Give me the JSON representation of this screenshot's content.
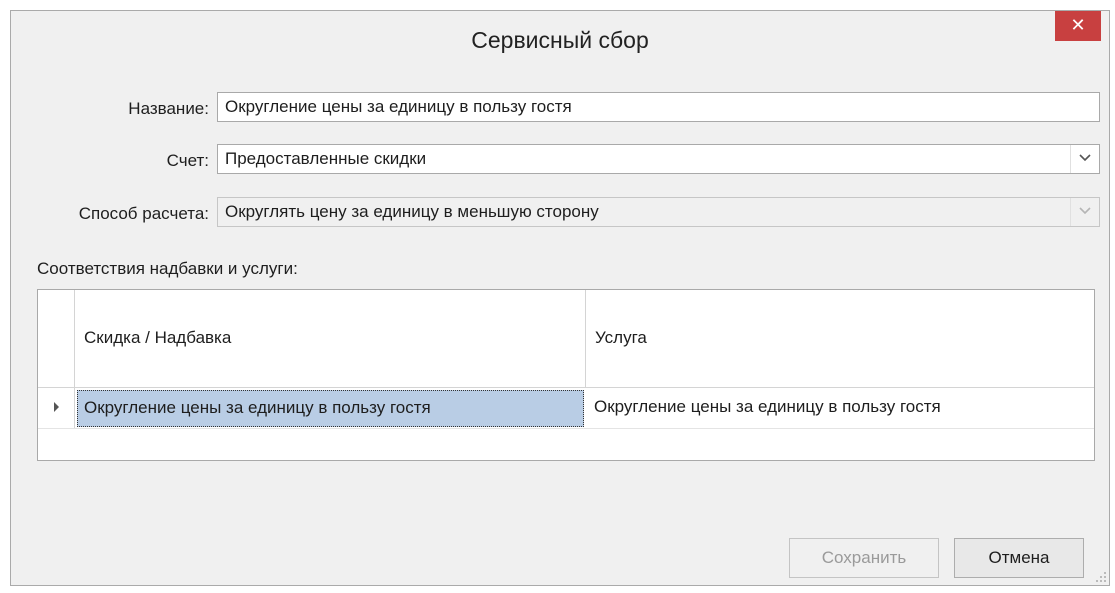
{
  "window": {
    "title": "Сервисный сбор",
    "close_glyph": "✕"
  },
  "form": {
    "name_label": "Название:",
    "name_value": "Округление цены за единицу в пользу гостя",
    "account_label": "Счет:",
    "account_value": "Предоставленные скидки",
    "method_label": "Способ расчета:",
    "method_value": "Округлять цену за единицу в меньшую сторону"
  },
  "mapping": {
    "section_label": "Соответствия надбавки и услуги:",
    "columns": [
      "Скидка / Надбавка",
      "Услуга"
    ],
    "rows": [
      [
        "Округление цены за единицу в пользу гостя",
        "Округление цены за единицу в пользу гостя"
      ]
    ]
  },
  "buttons": {
    "save": "Сохранить",
    "cancel": "Отмена"
  },
  "colors": {
    "close_bg": "#c84040",
    "selected_cell": "#b9cde5"
  }
}
